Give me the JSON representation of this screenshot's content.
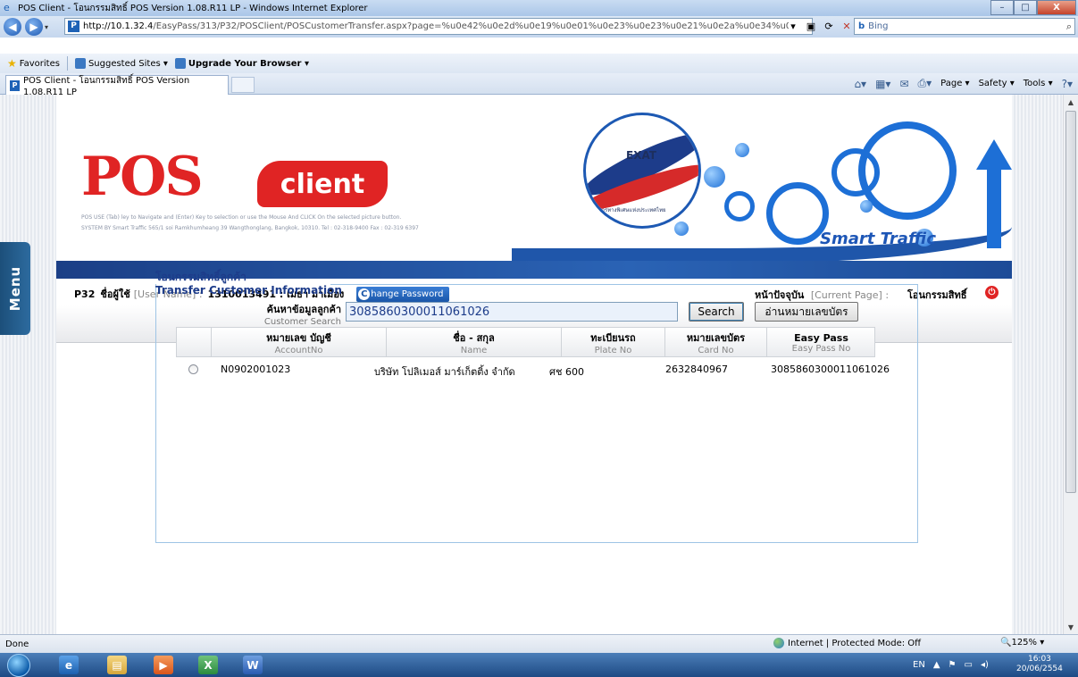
{
  "window": {
    "title": "POS Client - โอนกรรมสิทธิ์ POS Version 1.08.R11 LP - Windows Internet Explorer",
    "url_host": "http://10.1.32.4",
    "url_rest": "/EasyPass/313/P32/POSClient/POSCustomerTransfer.aspx?page=%u0e42%u0e2d%u0e19%u0e01%u0e23%u0e23%u0e21%u0e2a%u0e34%u0e17%u0e18%u0e34%u",
    "search_placeholder": "Bing",
    "minimize": "–",
    "maximize": "□",
    "close": "X"
  },
  "favorites": {
    "favorites_label": "Favorites",
    "suggested_sites": "Suggested Sites ▾",
    "upgrade": "Upgrade Your Browser ▾"
  },
  "tab": {
    "label": "POS Client - โอนกรรมสิทธิ์ POS Version 1.08.R11 LP"
  },
  "commandbar": {
    "page": "Page ▾",
    "safety": "Safety ▾",
    "tools": "Tools ▾"
  },
  "side": {
    "menu_label": "Menu"
  },
  "banner": {
    "pos": "POS",
    "client": "client",
    "sub1": "POS USE (Tab) ley to Navigate and (Enter) Key to selection or use the Mouse And CLICK On the selected picture button.",
    "sub2": "SYSTEM BY Smart Traffic 565/1 soi Ramkhumheang 39 Wangthonglang, Bangkok, 10310. Tel : 02-318-9400 Fax : 02-319 6397",
    "exat": "EXAT",
    "exat_sub": "การทางพิเศษแห่งประเทศไทย",
    "smart_traffic": "Smart Traffic"
  },
  "user": {
    "station": "P32",
    "name_label_th": "ชื่อผู้ใช้",
    "name_label_en": "[User Name] :",
    "name_value": "1310013491 : เมธา มาเมือง",
    "change_password_icon": "C",
    "change_password": "hange Password",
    "current_page_label_th": "หน้าปัจจุบัน",
    "current_page_label_en": "[Current Page] :",
    "current_page_value": "โอนกรรมสิทธิ์"
  },
  "form": {
    "title_th": "โอนกรรมสิทธิ์ลูกค้า",
    "title_en": "Transfer Customer Information",
    "search_label_th": "ค้นหาข้อมูลลูกค้า",
    "search_label_en": "Customer Search",
    "search_value": "3085860300011061026",
    "search_button": "Search",
    "read_card_button": "อ่านหมายเลขบัตร"
  },
  "table": {
    "columns": [
      {
        "th": "หมายเลข บัญชี",
        "en": "AccountNo"
      },
      {
        "th": "ชื่อ - สกุล",
        "en": "Name"
      },
      {
        "th": "ทะเบียนรถ",
        "en": "Plate No"
      },
      {
        "th": "หมายเลขบัตร",
        "en": "Card No"
      },
      {
        "th": "Easy Pass",
        "en": "Easy Pass No"
      }
    ],
    "rows": [
      {
        "account": "N0902001023",
        "name": "บริษัท โปลิเมอส์ มาร์เก็ตติ้ง จำกัด",
        "plate": "ศช 600",
        "card": "2632840967",
        "easypass": "3085860300011061026"
      }
    ]
  },
  "status": {
    "done": "Done",
    "zone": "Internet | Protected Mode: Off",
    "zoom": "🔍125% ▾"
  },
  "taskbar": {
    "lang": "EN",
    "time": "16:03",
    "date": "20/06/2554"
  },
  "colors": {
    "accent": "#1d56b6",
    "pos_red": "#e02424"
  }
}
